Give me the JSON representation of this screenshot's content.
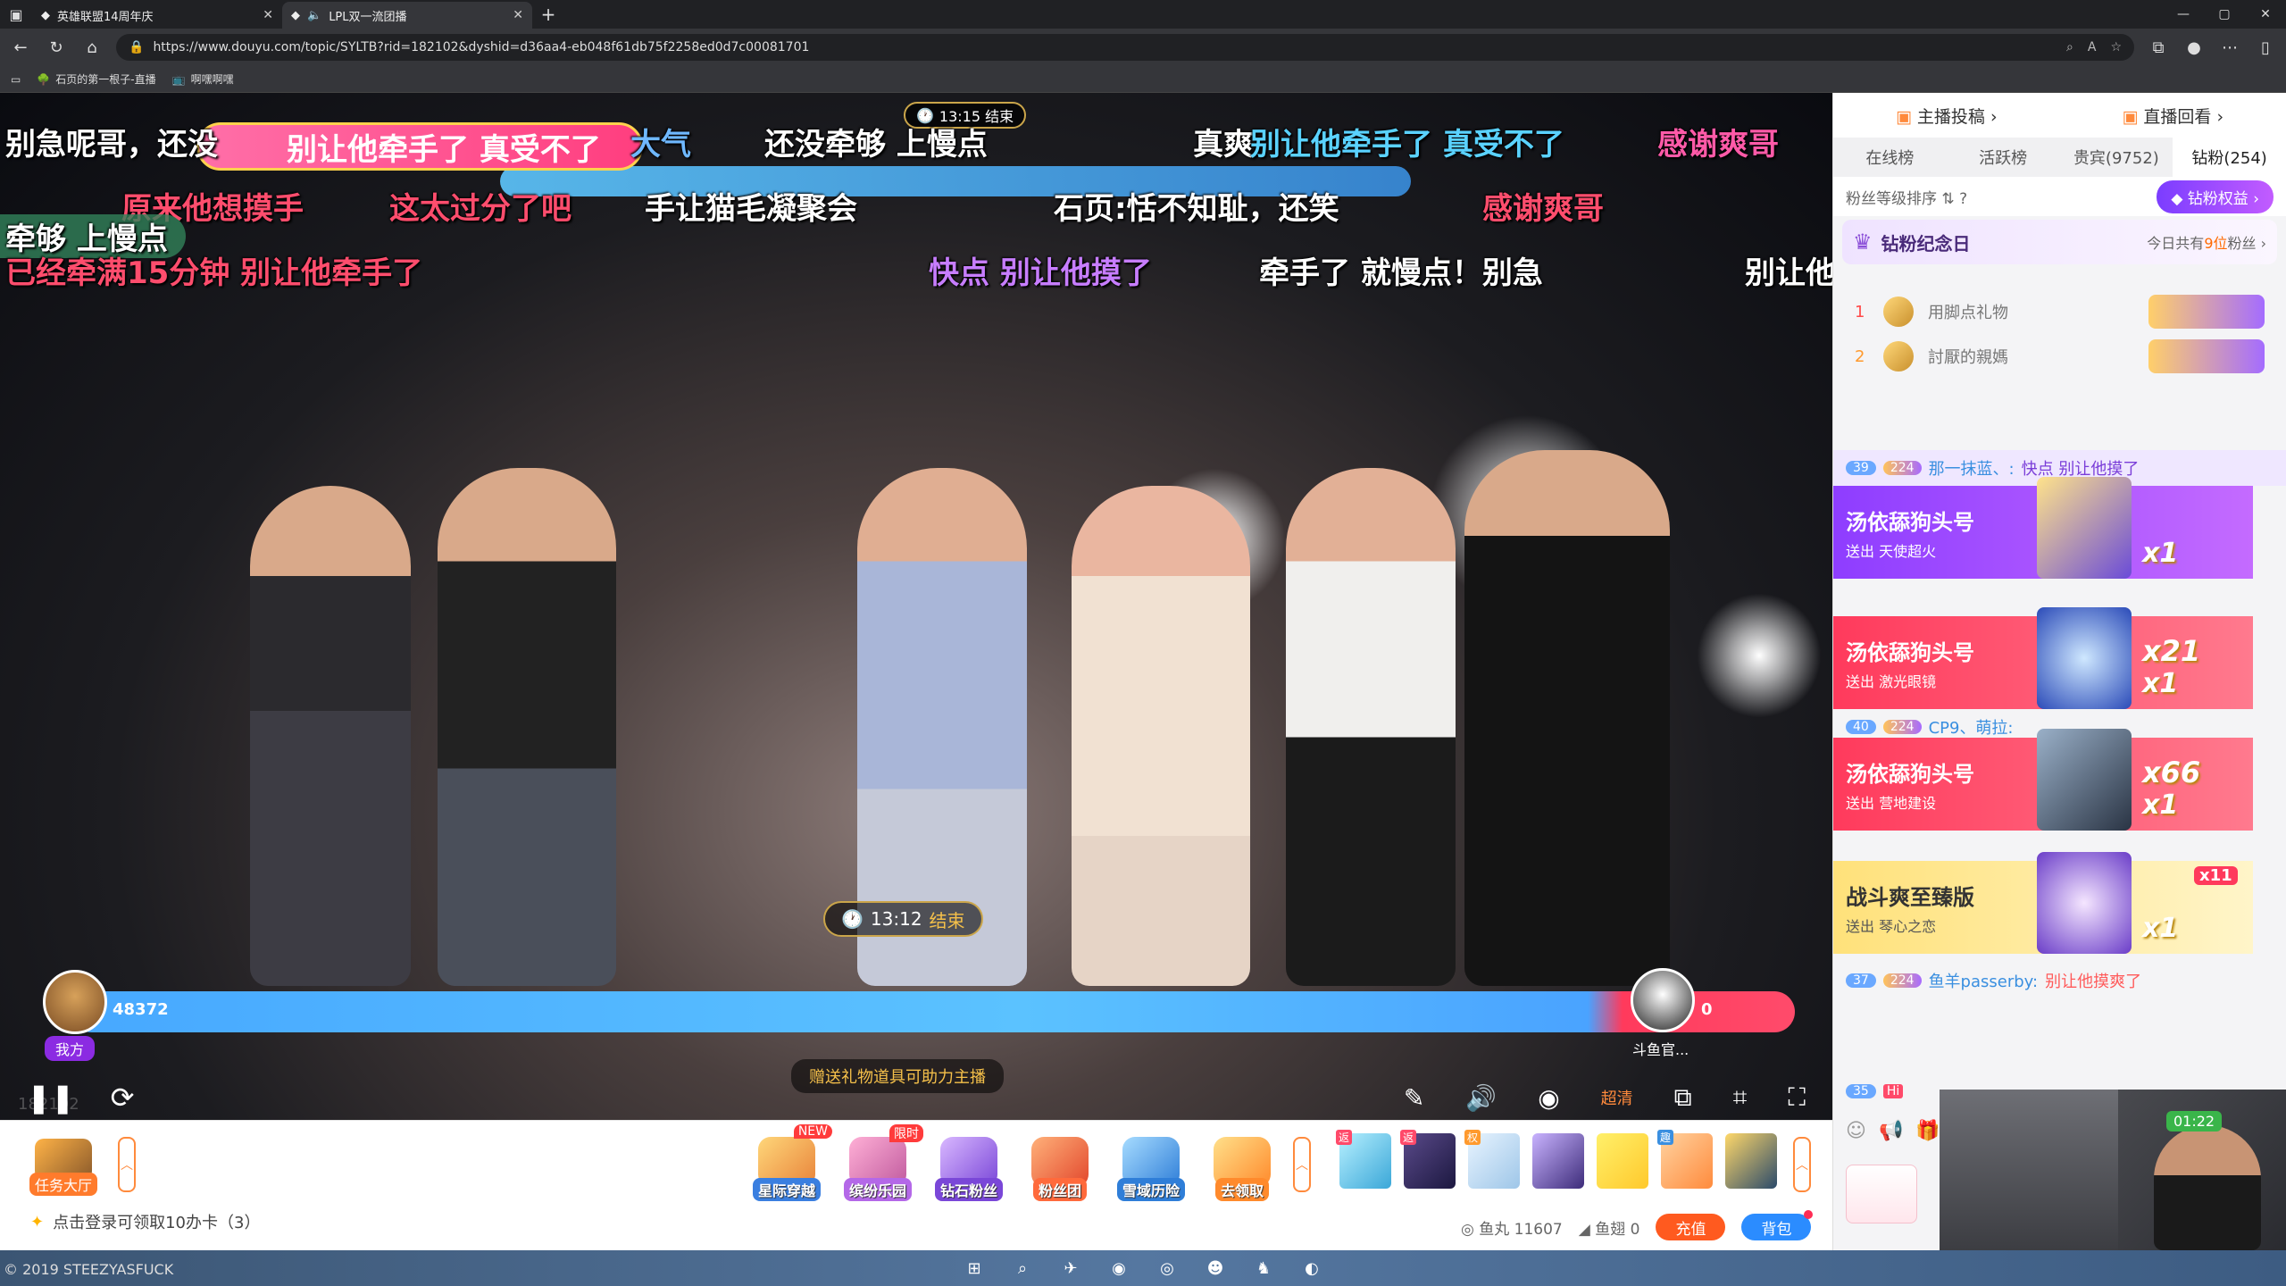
{
  "browser": {
    "tabs": [
      {
        "title": "英雄联盟14周年庆",
        "active": false
      },
      {
        "title": "LPL双一流团播",
        "active": true
      }
    ],
    "url": "https://www.douyu.com/topic/SYLTB?rid=182102&dyshid=d36aa4-eb048f61db75f2258ed0d7c00081701",
    "bookmarks": [
      "石页的第一根子-直播",
      "啊嘿啊嘿"
    ]
  },
  "video": {
    "banner_pink": "别让他牵手了 真受不了",
    "timer_top": "13:15 结束",
    "timer_mid_time": "13:12",
    "timer_mid_end": "结束",
    "pk_left_score": "48372",
    "pk_right_score": "0",
    "my_side": "我方",
    "opponent_name": "斗鱼官...",
    "gift_hint": "赠送礼物道具可助力主播",
    "hd": "超清",
    "room_no": "182102",
    "danmaku": [
      {
        "text": "别急呢哥，还没",
        "color": "#ffffff"
      },
      {
        "text": "大气",
        "color": "#6fb8ff"
      },
      {
        "text": "还没牵够 上慢点",
        "color": "#ffffff"
      },
      {
        "text": "真爽",
        "color": "#ffffff"
      },
      {
        "text": "别让他牵手了 真受不了",
        "color": "#5ad2ff"
      },
      {
        "text": "感谢爽哥",
        "color": "#ff5aa8"
      },
      {
        "text": "原来他想摸手",
        "color": "#ff4d6d"
      },
      {
        "text": "这太过分了吧",
        "color": "#ff4d6d"
      },
      {
        "text": "手让猫毛凝聚会",
        "color": "#ffffff"
      },
      {
        "text": "石页:恬不知耻，还笑",
        "color": "#ffffff"
      },
      {
        "text": "感谢爽哥",
        "color": "#ff4d6d"
      },
      {
        "text": "牵够 上慢点",
        "color": "#ffffff"
      },
      {
        "text": "已经牵满15分钟 别让他牵手了",
        "color": "#ff4d6d"
      },
      {
        "text": "快点 别让他摸了",
        "color": "#c77dff"
      },
      {
        "text": "牵手了 就慢点！别急",
        "color": "#ffffff"
      },
      {
        "text": "别让他",
        "color": "#ffffff"
      }
    ]
  },
  "giftbar": {
    "task_label": "任务大厅",
    "gifts": [
      {
        "label": "星际穿越",
        "tag": "NEW",
        "c1": "#ffd77a",
        "c2": "#e8833a"
      },
      {
        "label": "缤纷乐园",
        "tag": "限时",
        "c1": "#ffb0d6",
        "c2": "#c05a9e"
      },
      {
        "label": "钻石粉丝",
        "tag": "",
        "c1": "#d9b8ff",
        "c2": "#7a47d8"
      },
      {
        "label": "粉丝团",
        "tag": "",
        "c1": "#ffb17a",
        "c2": "#e2472c"
      },
      {
        "label": "雪域历险",
        "tag": "",
        "c1": "#a7dcff",
        "c2": "#2f7ed8"
      },
      {
        "label": "去领取",
        "tag": "",
        "c1": "#ffe08a",
        "c2": "#ff8a2c"
      }
    ],
    "login_tip": "点击登录可领取10办卡（3）",
    "fishball_label": "鱼丸 11607",
    "fishwing_label": "鱼翅 0",
    "charge": "充值",
    "backpack": "背包"
  },
  "sidebar": {
    "top_left": "主播投稿",
    "top_right": "直播回看",
    "tabs": [
      "在线榜",
      "活跃榜",
      "贵宾(9752)",
      "钻粉(254)"
    ],
    "sort_label": "粉丝等级排序",
    "perk_button": "钻粉权益",
    "anniv_title": "钻粉纪念日",
    "anniv_right_pre": "今日共有",
    "anniv_right_num": "9位",
    "anniv_right_post": "粉丝",
    "rank": [
      {
        "n": "1",
        "name": "用脚点礼物"
      },
      {
        "n": "2",
        "name": "討厭的親媽"
      }
    ],
    "chat": [
      {
        "lvl": "39",
        "badge": "224",
        "name": "那一抹蓝、:",
        "msg": "快点 别让他摸了"
      },
      {
        "lvl": "40",
        "badge": "224",
        "name": "CP9、萌拉:",
        "msg": ""
      },
      {
        "lvl": "37",
        "badge": "224",
        "name": "鱼羊passerby:",
        "msg": "别让他摸爽了"
      },
      {
        "lvl": "35",
        "badge": "",
        "name": "",
        "msg": ""
      }
    ],
    "gift_cards": [
      {
        "who": "汤依舔狗头号",
        "sub": "送出  天使超火",
        "cnt": "",
        "cnt1": "x1",
        "bg": "linear-gradient(90deg,#8e3dff,#c46bff)"
      },
      {
        "who": "汤依舔狗头号",
        "sub": "送出  激光眼镜",
        "cnt": "x21",
        "cnt1": "x1",
        "bg": "linear-gradient(90deg,#ff3a5c,#ff7a8e)"
      },
      {
        "who": "汤依舔狗头号",
        "sub": "送出  营地建设",
        "cnt": "x66",
        "cnt1": "x1",
        "bg": "linear-gradient(90deg,#ff3a5c,#ff7a8e)"
      },
      {
        "who": "战斗爽至臻版",
        "sub": "送出  琴心之恋",
        "cnt": "x11",
        "cnt1": "x1",
        "bg": "linear-gradient(90deg,#ffe17a,#fff5c9)"
      }
    ],
    "cam_timer": "01:22"
  },
  "watermark": "© 2019 STEEZYASFUCK"
}
